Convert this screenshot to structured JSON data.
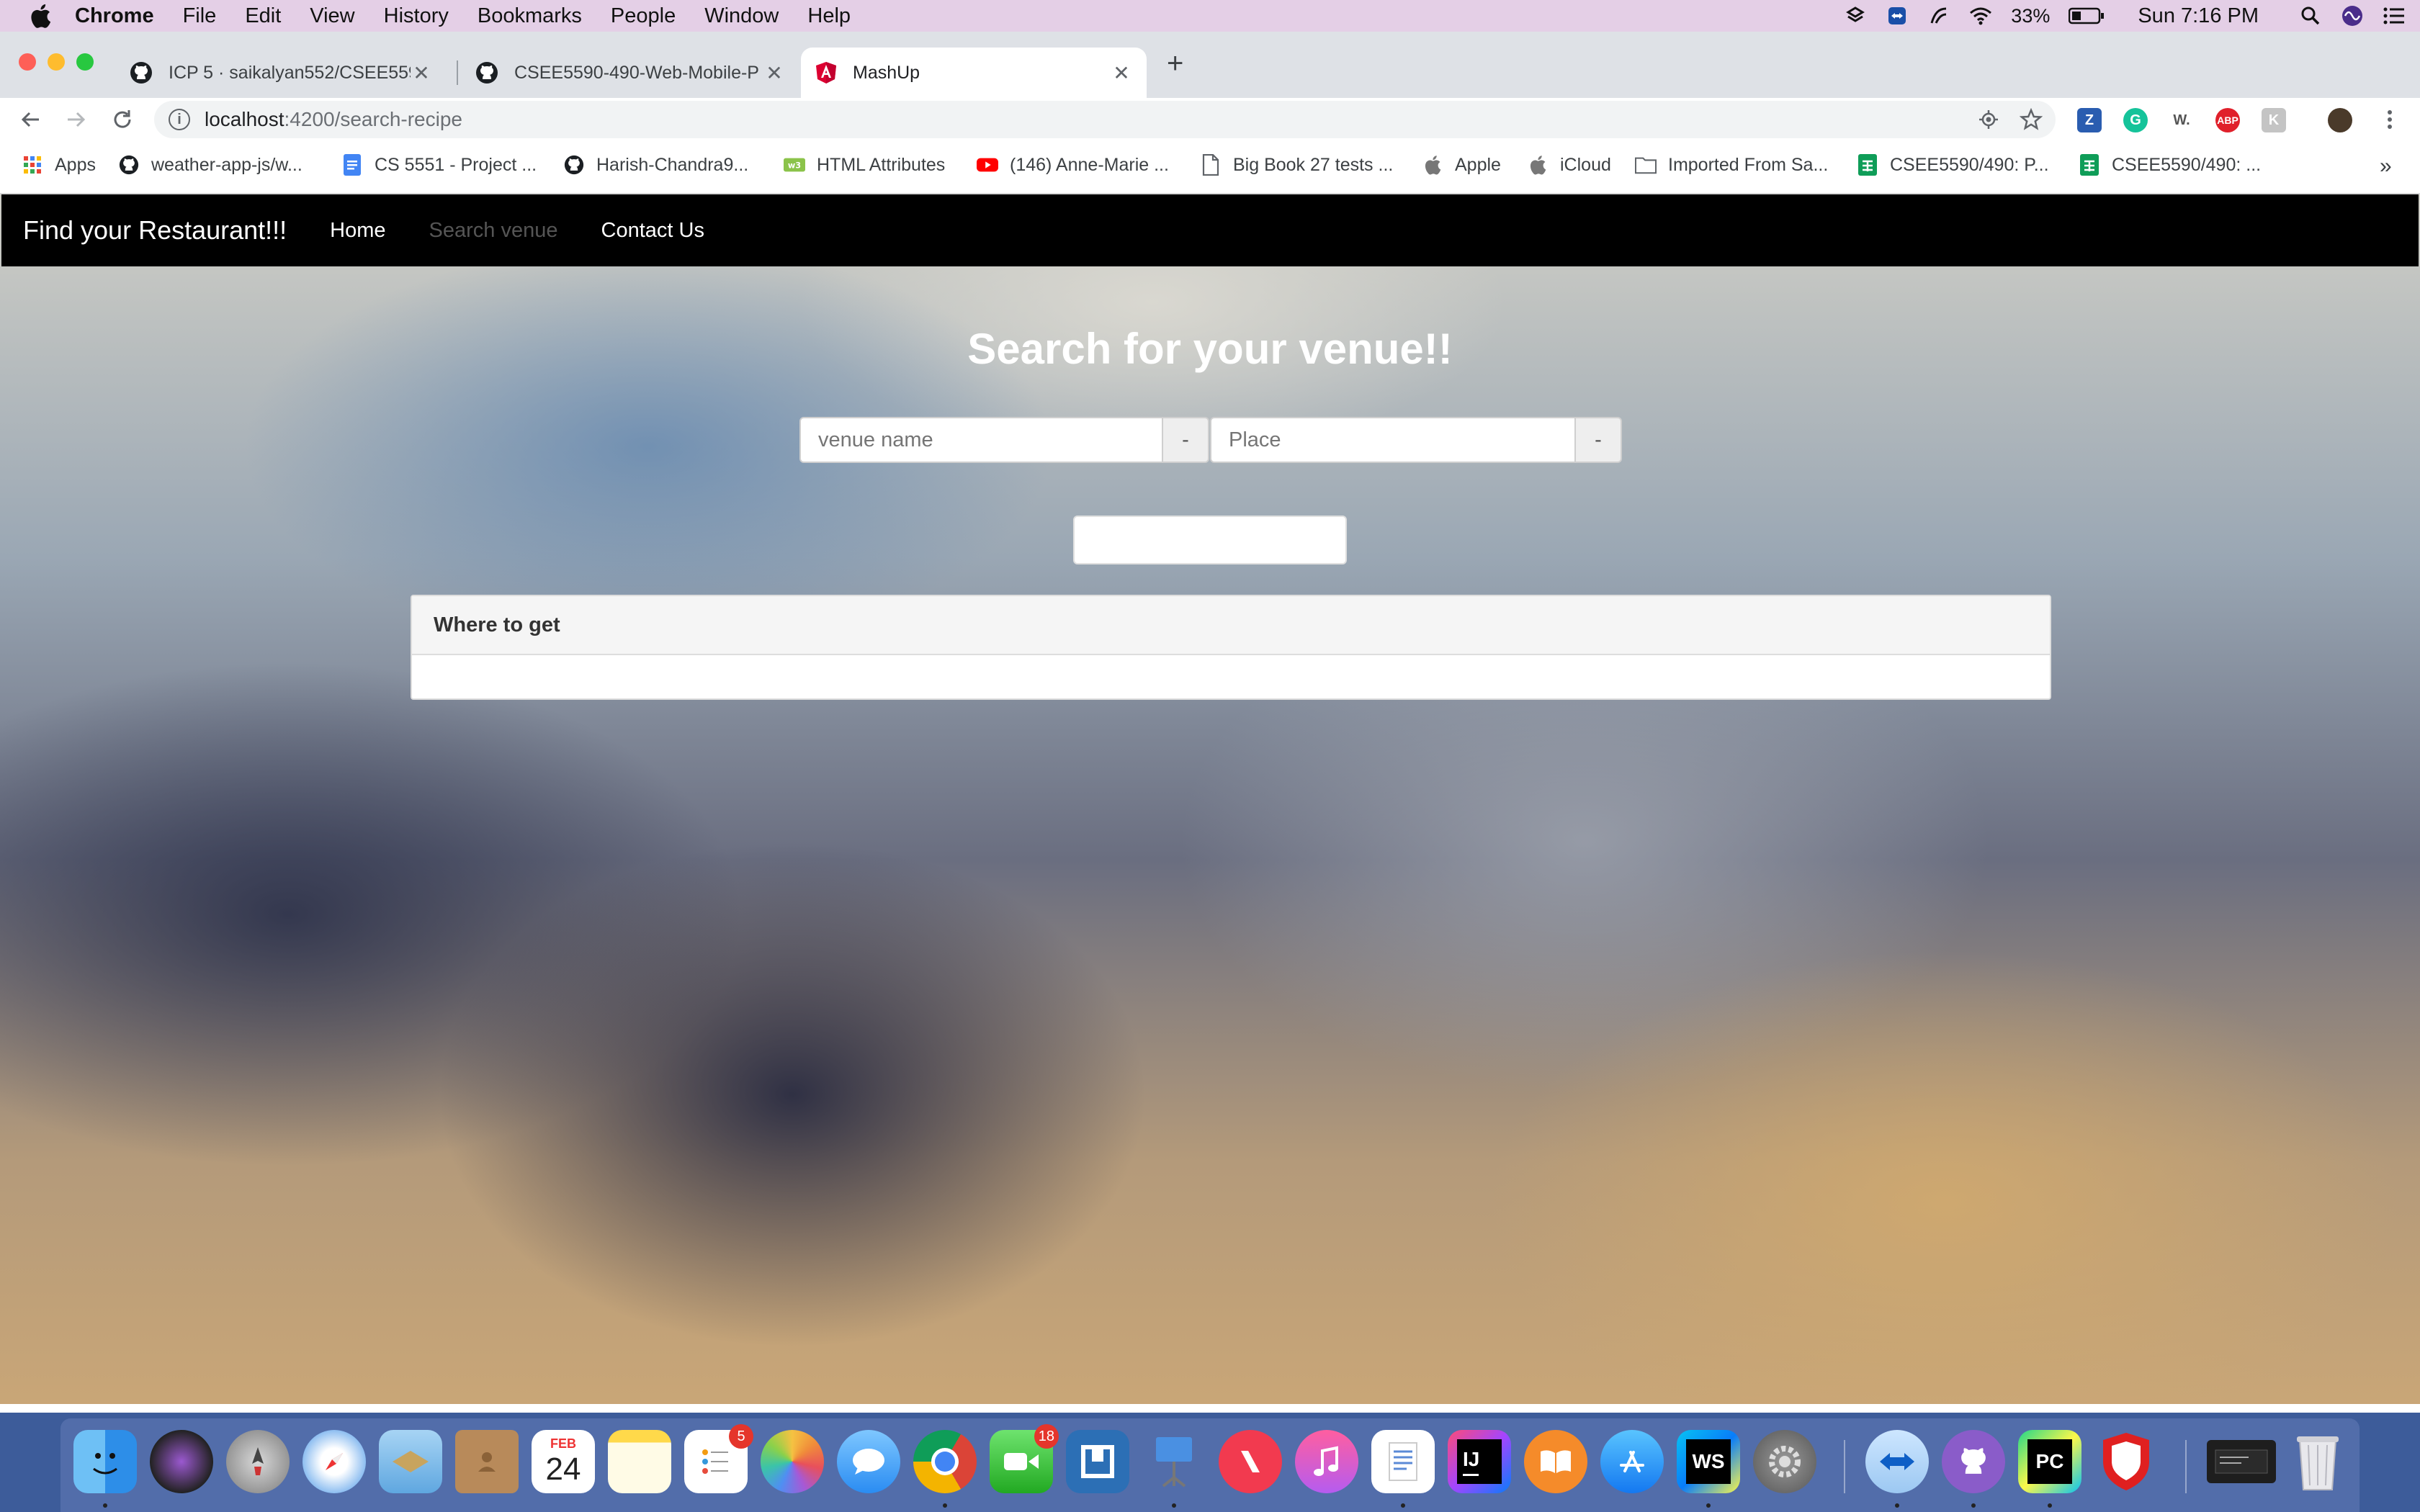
{
  "menubar": {
    "app": "Chrome",
    "items": [
      "File",
      "Edit",
      "View",
      "History",
      "Bookmarks",
      "People",
      "Window",
      "Help"
    ],
    "battery": "33%",
    "clock": "Sun 7:16 PM"
  },
  "tabs": [
    {
      "title": "ICP 5 · saikalyan552/CSEE5590",
      "icon": "github-icon",
      "active": false
    },
    {
      "title": "CSEE5590-490-Web-Mobile-P",
      "icon": "github-icon",
      "active": false
    },
    {
      "title": "MashUp",
      "icon": "angular-icon",
      "active": true
    }
  ],
  "omnibox": {
    "host": "localhost",
    "path": ":4200/search-recipe"
  },
  "bookmarks": [
    {
      "label": "Apps",
      "icon": "apps-grid-icon"
    },
    {
      "label": "weather-app-js/w...",
      "icon": "github-icon"
    },
    {
      "label": "CS 5551 - Project ...",
      "icon": "docs-icon"
    },
    {
      "label": "Harish-Chandra9...",
      "icon": "github-icon"
    },
    {
      "label": "HTML Attributes",
      "icon": "w3-icon"
    },
    {
      "label": "(146) Anne-Marie ...",
      "icon": "youtube-icon"
    },
    {
      "label": "Big Book 27 tests ...",
      "icon": "page-icon"
    },
    {
      "label": "Apple",
      "icon": "apple-icon"
    },
    {
      "label": "iCloud",
      "icon": "apple-icon"
    },
    {
      "label": "Imported From Sa...",
      "icon": "folder-icon"
    },
    {
      "label": "CSEE5590/490: P...",
      "icon": "sheets-icon"
    },
    {
      "label": "CSEE5590/490: ...",
      "icon": "sheets-icon"
    }
  ],
  "bookmarks_more": "»",
  "page": {
    "brand": "Find your Restaurant!!!",
    "nav": [
      "Home",
      "Search venue",
      "Contact Us"
    ],
    "heading": "Search for your venue!!",
    "venue_placeholder": "venue name",
    "place_placeholder": "Place",
    "addon": "-",
    "panel_title": "Where to get"
  },
  "dock": {
    "badges": {
      "reminders": "5",
      "facetime": "18"
    },
    "calendar_month": "FEB",
    "calendar_day": "24"
  }
}
